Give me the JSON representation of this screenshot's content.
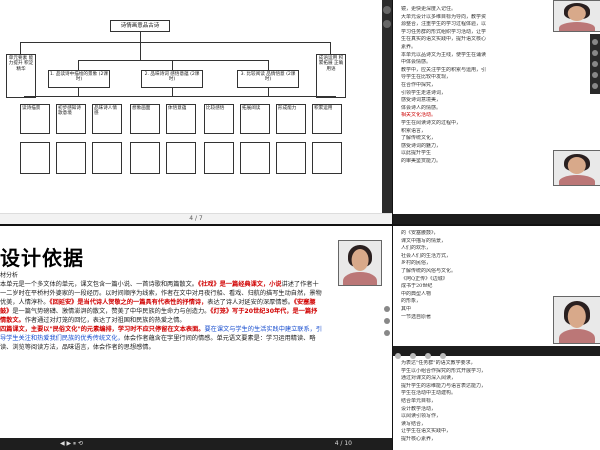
{
  "slide1": {
    "title": "诗情画意品古诗",
    "left_col_top": "单元要素 能力提升 积淀精华",
    "right_col_top": "成语运用 积累拓展 正确用语",
    "mid_boxes": [
      "1. 品读诗中描绘的景象 (2课时)",
      "2. 品味诗词 感悟意蕴 (2课时)",
      "3. 比较阅读 品情悟意 (2课时)"
    ],
    "bottom_boxes": [
      "读诗描景",
      "初步感知诗歌意境",
      "品味诗人情感",
      "想象画面",
      "体悟意蕴",
      "比较感悟",
      "拓展阅读",
      "形成能力",
      "积累运用"
    ],
    "page": "4 / 7"
  },
  "doc1": {
    "lines": [
      "镜，更快更深度入记住。",
      "大单元设计以多维目标为导向，教学资",
      "源整合，注重学生的学习过程体验，以",
      "学习任务群的形式组织学习活动，让学",
      "生在真实的语文实践中，提升语文核心",
      "素养。",
      "本单元以品诗文为主线，使学生在诵读",
      "中体会情感。",
      "教学中，应关注学生的积累与运用，引",
      "导学生在比较中发现，",
      "在合作中探究，",
      "引领学生走进诗词，",
      "感受诗词意境美，",
      "体会诗人的情感。"
    ],
    "lines2": [
      "相关文化活动。",
      "学生在阅读诗文的过程中，",
      "积累语言，",
      "了解传统文化，",
      "感受诗词的魅力，",
      "以此提升学生",
      "的审美鉴赏能力。"
    ]
  },
  "slide2": {
    "title": "设计依据",
    "subtitle": "材分析",
    "para": [
      {
        "t": "本单元是一个多文体的单元，课文包含一篇小说、一首诗歌和两篇散文。",
        "c": ""
      },
      {
        "t": "《社戏》是一篇经典课文，小说",
        "c": "red"
      },
      {
        "t": "讲述了作者十一二岁时在平桥村外婆家的一段经历。以时间顺序为线索，",
        "c": ""
      },
      {
        "t": "作者在文中对月夜行船、",
        "c": ""
      },
      {
        "t": "看戏、归航的描写生动自然，景物优美，人情淳朴。",
        "c": ""
      },
      {
        "t": "《回延安》是当代诗人贺敬之的一篇具有代表性的抒情诗，",
        "c": "red"
      },
      {
        "t": "表达了诗人对延安的深厚情感。",
        "c": ""
      },
      {
        "t": "《安塞腰鼓》",
        "c": "red"
      },
      {
        "t": "是一篇气势磅礴、激情澎湃的散文，赞美了中华民族的生命力与创造力。",
        "c": ""
      },
      {
        "t": "《灯笼》写于20世纪30年代，是一篇抒情散文。",
        "c": "red"
      },
      {
        "t": "作者通过对灯笼的回忆，表达了对祖国和民族的热爱之情。",
        "c": ""
      },
      {
        "t": "四篇课文，主要以\"民俗文化\"的元素编排，学习时不应只停留在文本表面。",
        "c": "red"
      },
      {
        "t": "要在课文与学生的生活实践中建立联系，引导学生关注和热爱我们民族的优秀传统文化，",
        "c": "blue"
      },
      {
        "t": "体会作者蕴含在字里行间的情感。",
        "c": ""
      },
      {
        "t": "单元语文要素是：学习运用精读、略读、浏览等阅读方法，品味语言，",
        "c": ""
      },
      {
        "t": "体会作者的思想感情。",
        "c": ""
      }
    ],
    "controls": "◀  ▶  ⏸  ⟲",
    "page": "4 / 10"
  },
  "doc2": {
    "lines": [
      "的《安塞腰鼓》，",
      "课文中描写的情景，",
      "人们的欢乐，",
      "社会人们的生活方式，",
      "乡村的民俗，",
      "了解传统的风俗与文化。",
      "《阿Q正传》《边城》",
      "成书于20世纪",
      "中的典型人物",
      "的形象，",
      "其中",
      "一节选自原著"
    ],
    "lines2": [
      "为表达\"任务群\"的语文教学要求，",
      "学生以小组合作探究的形式开展学习，",
      "通过对课文的深入阅读，",
      "提升学生的思维能力与语言表达能力，",
      "学生在活动中主动建构。",
      "结合单元目标，",
      "设计教学活动，",
      "以阅读引领写作，",
      "读写结合，",
      "让学生在语文实践中，",
      "提升核心素养，",
      "提高语文能力。"
    ]
  }
}
